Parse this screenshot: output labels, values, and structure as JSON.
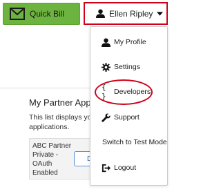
{
  "header": {
    "quick_bill_label": "Quick Bill",
    "user_name": "Ellen Ripley"
  },
  "partner": {
    "title": "My Partner Applica",
    "description": "This list displays your applications.",
    "app_name": "ABC Partner Private - OAuth Enabled",
    "app_button_label": "D"
  },
  "menu": {
    "items": [
      {
        "label": "My Profile",
        "icon": "person-icon"
      },
      {
        "label": "Settings",
        "icon": "gear-icon"
      },
      {
        "label": "Developers",
        "icon": "braces-icon",
        "highlighted": true
      },
      {
        "label": "Support",
        "icon": "wrench-icon"
      },
      {
        "label": "Switch to Test Mode"
      },
      {
        "label": "Logout",
        "icon": "logout-icon"
      }
    ]
  },
  "colors": {
    "quick_bill_bg": "#6db33f",
    "highlight_red": "#d0021b",
    "link_blue": "#2e6fc7"
  }
}
